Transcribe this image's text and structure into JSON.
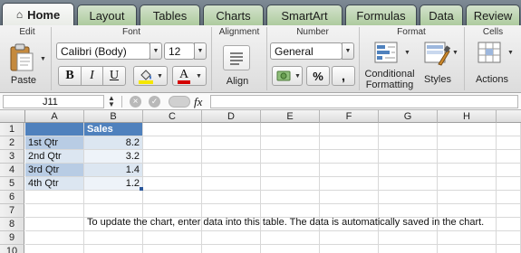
{
  "tabs": [
    "Home",
    "Layout",
    "Tables",
    "Charts",
    "SmartArt",
    "Formulas",
    "Data",
    "Review"
  ],
  "ribbon": {
    "groups": {
      "edit": "Edit",
      "font": "Font",
      "alignment": "Alignment",
      "number": "Number",
      "format": "Format",
      "cells": "Cells"
    },
    "paste_label": "Paste",
    "font_name": "Calibri (Body)",
    "font_size": "12",
    "bold": "B",
    "italic": "I",
    "underline": "U",
    "font_color_glyph": "A",
    "align_label": "Align",
    "number_format": "General",
    "percent": "%",
    "comma": ",",
    "conditional_label_1": "Conditional",
    "conditional_label_2": "Formatting",
    "styles_label": "Styles",
    "actions_label": "Actions",
    "colors": {
      "highlight": "#f5e700",
      "font_color": "#d40000"
    }
  },
  "formula_bar": {
    "name_box": "J11",
    "fx": "fx",
    "value": ""
  },
  "sheet": {
    "columns": [
      "A",
      "B",
      "C",
      "D",
      "E",
      "F",
      "G",
      "H"
    ],
    "rows": [
      "1",
      "2",
      "3",
      "4",
      "5",
      "6",
      "7",
      "8",
      "9",
      "10"
    ],
    "header_cell": "Sales",
    "data": [
      {
        "label": "1st Qtr",
        "value": "8.2"
      },
      {
        "label": "2nd Qtr",
        "value": "3.2"
      },
      {
        "label": "3rd Qtr",
        "value": "1.4"
      },
      {
        "label": "4th Qtr",
        "value": "1.2"
      }
    ],
    "note": "To update the chart, enter data into this table. The data is automatically saved in the chart.",
    "colors": {
      "header_fill": "#4f81bd",
      "band_a": "#b8cce4",
      "band_b": "#dce6f1"
    }
  }
}
